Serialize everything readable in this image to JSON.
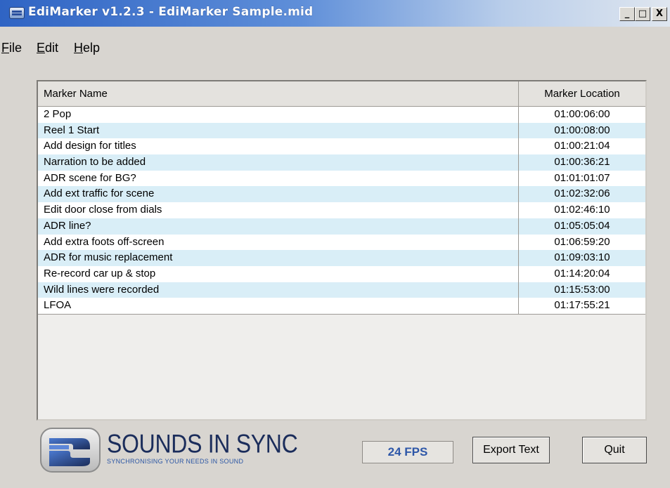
{
  "window": {
    "title": "EdiMarker v1.2.3 - EdiMarker Sample.mid",
    "minimize": "_",
    "maximize": "□",
    "close": "X"
  },
  "menu": {
    "file": {
      "hot": "F",
      "rest": "ile"
    },
    "edit": {
      "hot": "E",
      "rest": "dit"
    },
    "help": {
      "hot": "H",
      "rest": "elp"
    }
  },
  "list": {
    "headers": {
      "name": "Marker Name",
      "location": "Marker Location"
    },
    "rows": [
      {
        "name": "2 Pop",
        "location": "01:00:06:00"
      },
      {
        "name": "Reel 1 Start",
        "location": "01:00:08:00"
      },
      {
        "name": "Add design for titles",
        "location": "01:00:21:04"
      },
      {
        "name": "Narration to be added",
        "location": "01:00:36:21"
      },
      {
        "name": "ADR scene for BG?",
        "location": "01:01:01:07"
      },
      {
        "name": "Add ext traffic for scene",
        "location": "01:02:32:06"
      },
      {
        "name": "Edit door close from dials",
        "location": "01:02:46:10"
      },
      {
        "name": "ADR line?",
        "location": "01:05:05:04"
      },
      {
        "name": "Add extra foots off-screen",
        "location": "01:06:59:20"
      },
      {
        "name": "ADR for music replacement",
        "location": "01:09:03:10"
      },
      {
        "name": "Re-record car up & stop",
        "location": "01:14:20:04"
      },
      {
        "name": "Wild lines were recorded",
        "location": "01:15:53:00"
      },
      {
        "name": "LFOA",
        "location": "01:17:55:21"
      }
    ]
  },
  "footer": {
    "brand": "SOUNDS IN SYNC",
    "tagline": "SYNCHRONISING YOUR NEEDS IN SOUND",
    "fps": "24 FPS",
    "export_label": "Export Text",
    "quit_label": "Quit"
  },
  "colors": {
    "row_alt": "#d9eef7",
    "brand": "#1b2d5b",
    "fps_text": "#2e57a8"
  }
}
